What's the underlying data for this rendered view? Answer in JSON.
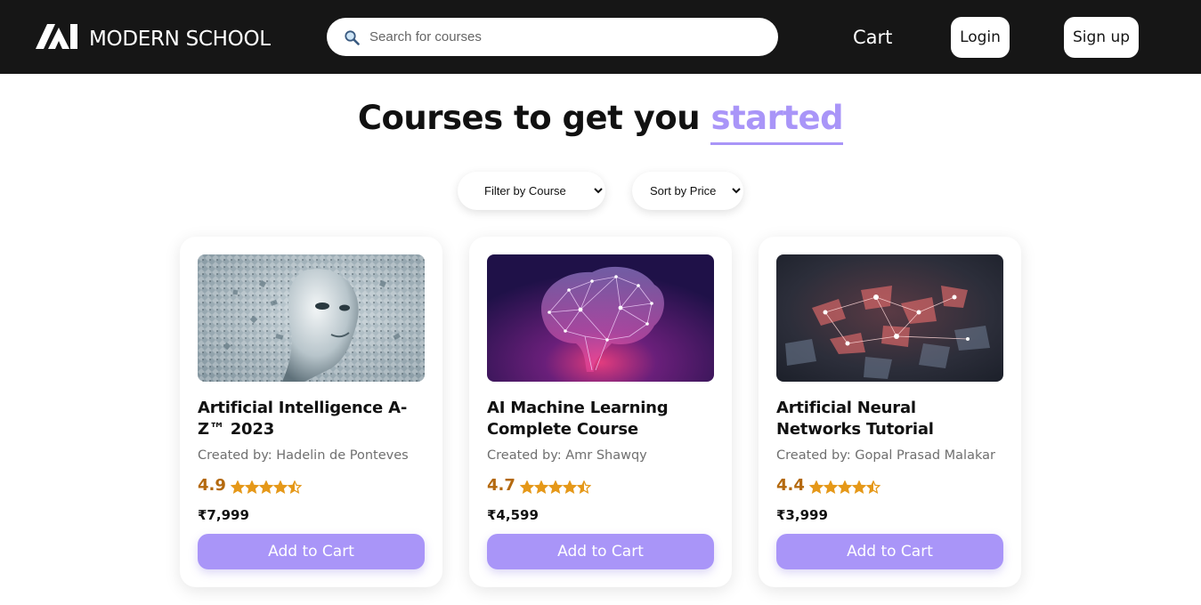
{
  "header": {
    "brand_name": "MODERN SCHOOL",
    "logo_icon": "modern-school-logo-icon",
    "search": {
      "placeholder": "Search for courses",
      "value": "",
      "icon": "search-icon"
    },
    "cart_label": "Cart",
    "login_label": "Login",
    "signup_label": "Sign up"
  },
  "hero": {
    "title_prefix": "Courses to get you",
    "title_accent": "started",
    "accent_color": "#a995f8"
  },
  "filters": {
    "course_filter": {
      "selected": "Filter by Course"
    },
    "price_sort": {
      "selected": "Sort by Price"
    }
  },
  "courses": [
    {
      "title": "Artificial Intelligence A-Z™ 2023",
      "author": "Created by: Hadelin de Ponteves",
      "rating": "4.9",
      "stars": 4.5,
      "price": "₹7,999",
      "cta": "Add to Cart",
      "image": "ai-face-particles-image"
    },
    {
      "title": "AI Machine Learning Complete Course",
      "author": "Created by: Amr Shawqy",
      "rating": "4.7",
      "stars": 4.5,
      "price": "₹4,599",
      "cta": "Add to Cart",
      "image": "glowing-brain-image"
    },
    {
      "title": "Artificial Neural Networks Tutorial",
      "author": "Created by: Gopal Prasad Malakar",
      "rating": "4.4",
      "stars": 4.5,
      "price": "₹3,999",
      "cta": "Add to Cart",
      "image": "neural-network-nodes-image"
    }
  ],
  "colors": {
    "navbar": "#161616",
    "accent": "#a995f8",
    "rating": "#b4690e",
    "star": "#e59819"
  }
}
